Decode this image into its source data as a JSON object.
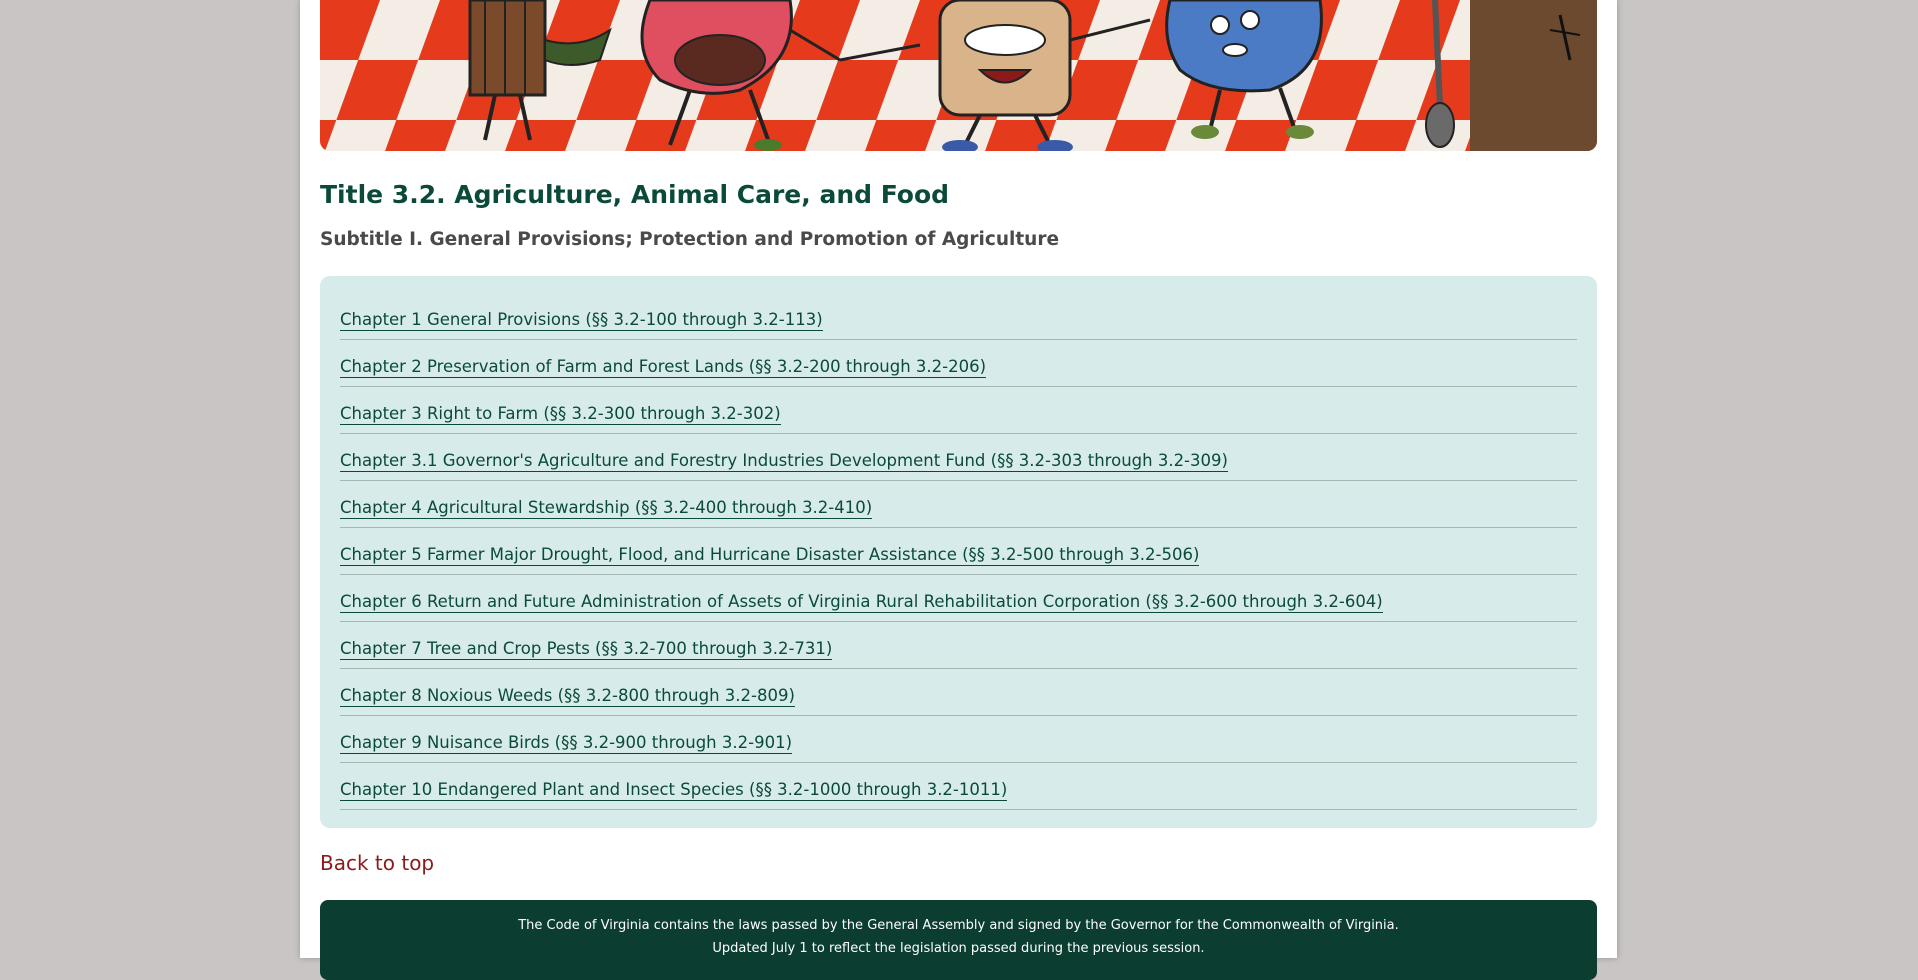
{
  "title": "Title 3.2. Agriculture, Animal Care, and Food",
  "subtitle": "Subtitle I. General Provisions; Protection and Promotion of Agriculture",
  "chapters": [
    {
      "label": "Chapter 1 General Provisions (§§ 3.2-100 through 3.2-113)"
    },
    {
      "label": "Chapter 2 Preservation of Farm and Forest Lands (§§ 3.2-200 through 3.2-206)"
    },
    {
      "label": "Chapter 3 Right to Farm (§§ 3.2-300 through 3.2-302)"
    },
    {
      "label": "Chapter 3.1 Governor's Agriculture and Forestry Industries Development Fund (§§ 3.2-303 through 3.2-309)"
    },
    {
      "label": "Chapter 4 Agricultural Stewardship (§§ 3.2-400 through 3.2-410)"
    },
    {
      "label": "Chapter 5 Farmer Major Drought, Flood, and Hurricane Disaster Assistance (§§ 3.2-500 through 3.2-506)"
    },
    {
      "label": "Chapter 6 Return and Future Administration of Assets of Virginia Rural Rehabilitation Corporation (§§ 3.2-600 through 3.2-604)"
    },
    {
      "label": "Chapter 7 Tree and Crop Pests (§§ 3.2-700 through 3.2-731)"
    },
    {
      "label": "Chapter 8 Noxious Weeds (§§ 3.2-800 through 3.2-809)"
    },
    {
      "label": "Chapter 9 Nuisance Birds (§§ 3.2-900 through 3.2-901)"
    },
    {
      "label": "Chapter 10 Endangered Plant and Insect Species (§§ 3.2-1000 through 3.2-1011)"
    }
  ],
  "back_to_top": "Back to top",
  "footer": {
    "line1": "The Code of Virginia contains the laws passed by the General Assembly and signed by the Governor for the Commonwealth of Virginia.",
    "line2": "Updated July 1 to reflect the legislation passed during the previous session."
  },
  "colors": {
    "title": "#0b4a3a",
    "link": "#0b4a3a",
    "panel": "#d7ecea",
    "back_to_top": "#8b1a1a",
    "footer_bg": "#0b3d31"
  }
}
